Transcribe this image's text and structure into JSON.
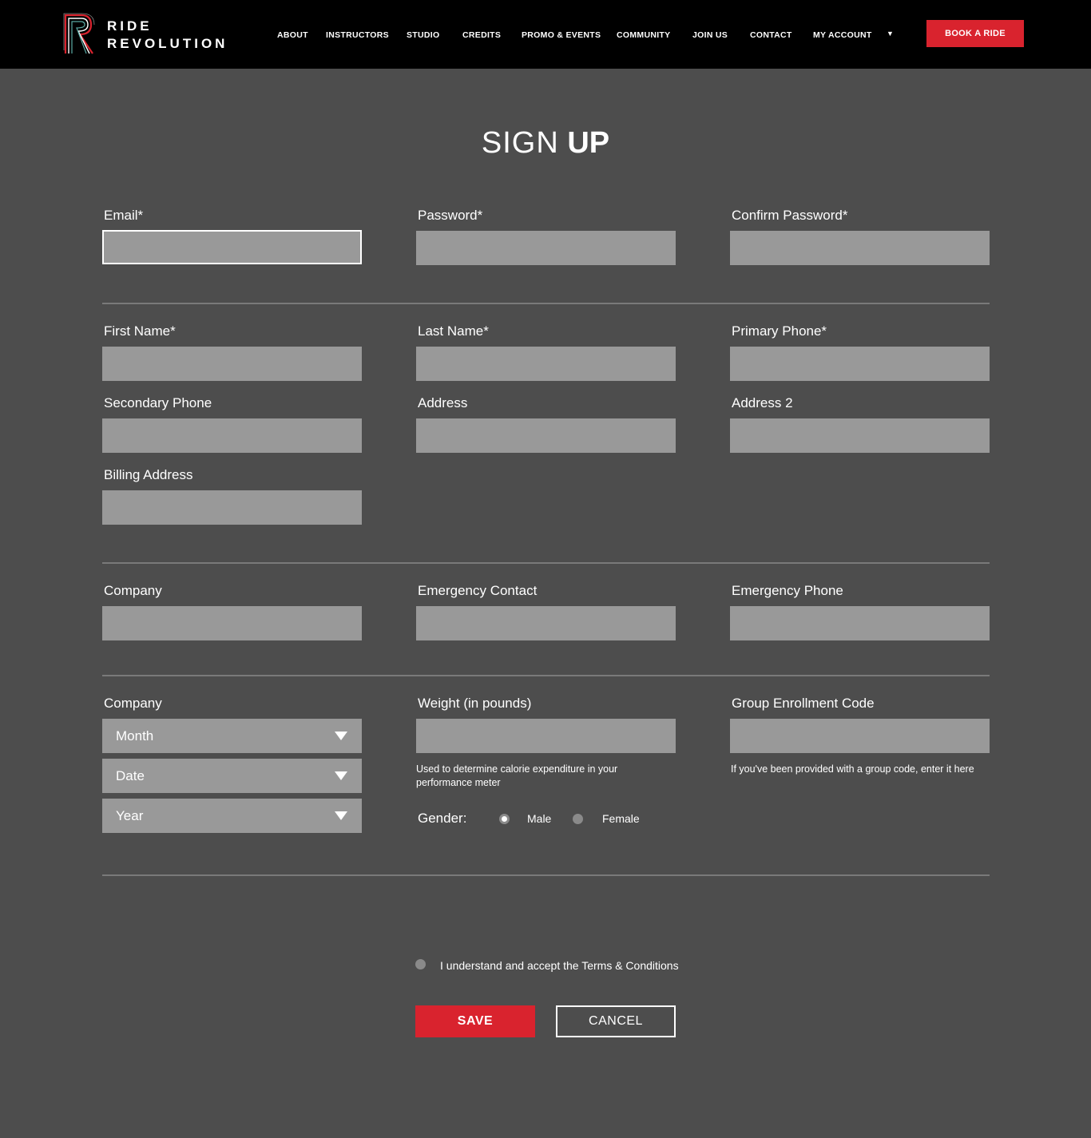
{
  "brand": {
    "line1": "RIDE",
    "line2": "REVOLUTION",
    "logo_icon": "r-monogram-icon",
    "accent_color": "#d9232e"
  },
  "nav": {
    "items": [
      "ABOUT",
      "INSTRUCTORS",
      "STUDIO",
      "CREDITS",
      "PROMO & EVENTS",
      "COMMUNITY",
      "JOIN US",
      "CONTACT",
      "MY ACCOUNT"
    ],
    "caret": "▼",
    "book_label": "BOOK A RIDE"
  },
  "title": {
    "light": "SIGN",
    "bold": "UP"
  },
  "fields": {
    "email": {
      "label": "Email*",
      "value": ""
    },
    "password": {
      "label": "Password*",
      "value": ""
    },
    "confirm_password": {
      "label": "Confirm Password*",
      "value": ""
    },
    "first_name": {
      "label": "First Name*",
      "value": ""
    },
    "last_name": {
      "label": "Last Name*",
      "value": ""
    },
    "primary_phone": {
      "label": "Primary Phone*",
      "value": ""
    },
    "secondary_phone": {
      "label": "Secondary Phone",
      "value": ""
    },
    "address": {
      "label": "Address",
      "value": ""
    },
    "address2": {
      "label": "Address 2",
      "value": ""
    },
    "billing_address": {
      "label": "Billing Address",
      "value": ""
    },
    "company": {
      "label": "Company",
      "value": ""
    },
    "emergency_contact": {
      "label": "Emergency Contact",
      "value": ""
    },
    "emergency_phone": {
      "label": "Emergency Phone",
      "value": ""
    },
    "weight": {
      "label": "Weight (in pounds)",
      "value": "",
      "help": "Used to determine calorie expenditure in your performance meter"
    },
    "group_code": {
      "label": "Group Enrollment Code",
      "value": "",
      "help": "If  you've been provided with a group code, enter it here"
    }
  },
  "birthday": {
    "label": "Company",
    "month": "Month",
    "date": "Date",
    "year": "Year"
  },
  "gender": {
    "label": "Gender:",
    "options": [
      "Male",
      "Female"
    ],
    "selected": "Male"
  },
  "terms": {
    "label": "I understand and accept the Terms & Conditions",
    "checked": false
  },
  "actions": {
    "save": "SAVE",
    "cancel": "CANCEL"
  }
}
